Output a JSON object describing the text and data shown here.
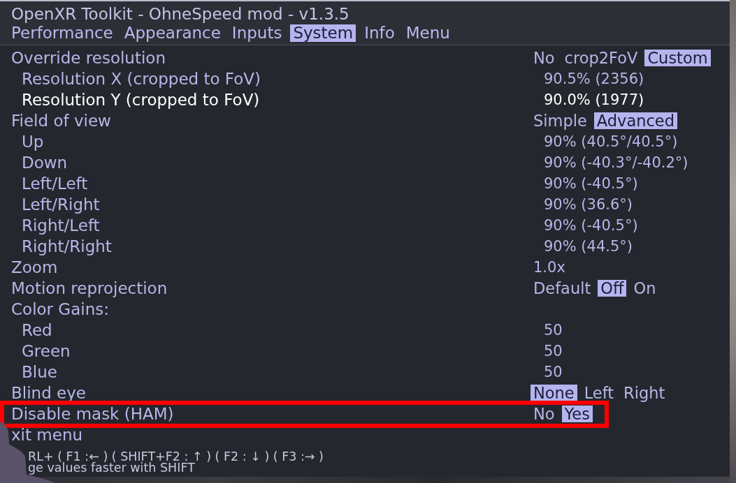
{
  "window": {
    "title": "OpenXR Toolkit - OhneSpeed mod - v1.3.5"
  },
  "tabs": [
    {
      "label": "Performance",
      "selected": false
    },
    {
      "label": "Appearance",
      "selected": false
    },
    {
      "label": "Inputs",
      "selected": false
    },
    {
      "label": "System",
      "selected": true
    },
    {
      "label": "Info",
      "selected": false
    },
    {
      "label": "Menu",
      "selected": false
    }
  ],
  "menu": {
    "rows": [
      {
        "label": "Override resolution",
        "kind": "choice",
        "selected": false,
        "highlighted": false,
        "options": [
          {
            "label": "No",
            "selected": false
          },
          {
            "label": "crop2FoV",
            "selected": false
          },
          {
            "label": "Custom",
            "selected": true
          }
        ],
        "children": [
          {
            "label": "Resolution X (cropped to FoV)",
            "kind": "value",
            "value": "90.5% (2356)",
            "selected": false,
            "highlighted": false
          },
          {
            "label": "Resolution Y (cropped to FoV)",
            "kind": "value",
            "value": "90.0% (1977)",
            "selected": true,
            "highlighted": false
          }
        ]
      },
      {
        "label": "Field of view",
        "kind": "choice",
        "selected": false,
        "highlighted": false,
        "options": [
          {
            "label": "Simple",
            "selected": false
          },
          {
            "label": "Advanced",
            "selected": true
          }
        ],
        "children": [
          {
            "label": "Up",
            "kind": "value",
            "value": "90% (40.5°/40.5°)",
            "selected": false,
            "highlighted": false
          },
          {
            "label": "Down",
            "kind": "value",
            "value": "90% (-40.3°/-40.2°)",
            "selected": false,
            "highlighted": false
          },
          {
            "label": "Left/Left",
            "kind": "value",
            "value": "90% (-40.5°)",
            "selected": false,
            "highlighted": false
          },
          {
            "label": "Left/Right",
            "kind": "value",
            "value": "90% (36.6°)",
            "selected": false,
            "highlighted": false
          },
          {
            "label": "Right/Left",
            "kind": "value",
            "value": "90% (-40.5°)",
            "selected": false,
            "highlighted": false
          },
          {
            "label": "Right/Right",
            "kind": "value",
            "value": "90% (44.5°)",
            "selected": false,
            "highlighted": false
          }
        ]
      },
      {
        "label": "Zoom",
        "kind": "value",
        "value": "1.0x",
        "selected": false,
        "highlighted": false
      },
      {
        "label": "Motion reprojection",
        "kind": "choice",
        "selected": false,
        "highlighted": false,
        "options": [
          {
            "label": "Default",
            "selected": false
          },
          {
            "label": "Off",
            "selected": true
          },
          {
            "label": "On",
            "selected": false
          }
        ]
      },
      {
        "label": "Color Gains:",
        "kind": "group",
        "selected": false,
        "highlighted": false,
        "children": [
          {
            "label": "Red",
            "kind": "value",
            "value": "50",
            "selected": false,
            "highlighted": false
          },
          {
            "label": "Green",
            "kind": "value",
            "value": "50",
            "selected": false,
            "highlighted": false
          },
          {
            "label": "Blue",
            "kind": "value",
            "value": "50",
            "selected": false,
            "highlighted": false
          }
        ]
      },
      {
        "label": "Blind eye",
        "kind": "choice",
        "selected": false,
        "highlighted": false,
        "options": [
          {
            "label": "None",
            "selected": true
          },
          {
            "label": "Left",
            "selected": false
          },
          {
            "label": "Right",
            "selected": false
          }
        ]
      },
      {
        "label": "Disable mask (HAM)",
        "kind": "choice",
        "selected": false,
        "highlighted": true,
        "options": [
          {
            "label": "No",
            "selected": false
          },
          {
            "label": "Yes",
            "selected": true
          }
        ]
      },
      {
        "label": "xit menu",
        "kind": "action",
        "selected": false,
        "highlighted": false
      }
    ]
  },
  "footer": {
    "lines": [
      "RL+ ( F1 :← ) ( SHIFT+F2 : ↑ ) ( F2 : ↓ ) ( F3 :→ )",
      "ge values faster with SHIFT"
    ]
  }
}
